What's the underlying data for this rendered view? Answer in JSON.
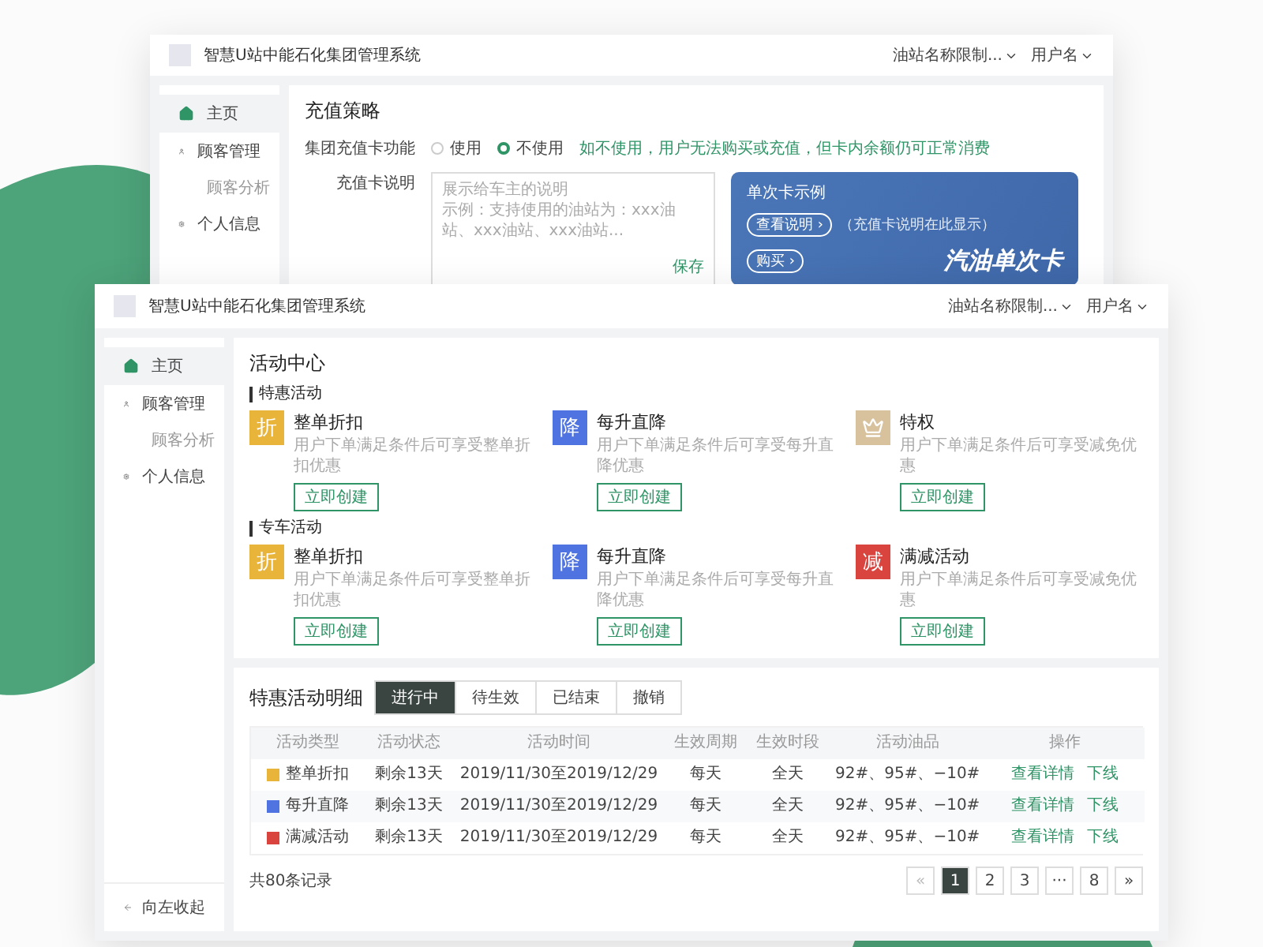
{
  "back_window": {
    "header": {
      "title": "智慧U站中能石化集团管理系统",
      "station": "油站名称限制...",
      "user": "用户名"
    },
    "sidebar": [
      {
        "label": "主页",
        "selected": true
      },
      {
        "label": "顾客管理",
        "selected": false,
        "children": [
          {
            "label": "顾客分析",
            "selected": false
          }
        ]
      },
      {
        "label": "个人信息",
        "selected": false
      }
    ],
    "content": {
      "title": "充值策略",
      "switch_label": "集团充值卡功能",
      "options": [
        {
          "label": "使用",
          "selected": false
        },
        {
          "label": "不使用",
          "selected": true
        }
      ],
      "hint": "如不使用，用户无法购买或充值，但卡内余额仍可正常消费",
      "desc_label": "充值卡说明",
      "placeholder": [
        "展示给车主的说明",
        "示例：支持使用的油站为：xxx油站、xxx油站、xxx油站..."
      ],
      "save": "保存",
      "card": {
        "title": "单次卡示例",
        "info_button": "查看说明 ›",
        "info_note": "（充值卡说明在此显示）",
        "buy_button": "购买 ›",
        "name": "汽油单次卡"
      }
    }
  },
  "front_window": {
    "header": {
      "title": "智慧U站中能石化集团管理系统",
      "station": "油站名称限制...",
      "user": "用户名"
    },
    "sidebar": [
      {
        "label": "主页",
        "selected": true
      },
      {
        "label": "顾客管理",
        "selected": false,
        "children": [
          {
            "label": "顾客分析",
            "selected": false
          }
        ]
      },
      {
        "label": "个人信息",
        "selected": false
      }
    ],
    "collapse": "向左收起",
    "activity_center": {
      "title": "活动中心",
      "sections": [
        {
          "title": "特惠活动",
          "items": [
            {
              "kind": "glyph",
              "glyph": "折",
              "color": "#e8b43a",
              "name": "整单折扣",
              "desc": "用户下单满足条件后可享受整单折扣优惠",
              "button": "立即创建"
            },
            {
              "kind": "glyph",
              "glyph": "降",
              "color": "#4f73e0",
              "name": "每升直降",
              "desc": "用户下单满足条件后可享受每升直降优惠",
              "button": "立即创建"
            },
            {
              "kind": "crown",
              "color": "#d8c29d",
              "name": "特权",
              "desc": "用户下单满足条件后可享受减免优惠",
              "button": "立即创建"
            }
          ]
        },
        {
          "title": "专车活动",
          "items": [
            {
              "kind": "glyph",
              "glyph": "折",
              "color": "#e8b43a",
              "name": "整单折扣",
              "desc": "用户下单满足条件后可享受整单折扣优惠",
              "button": "立即创建"
            },
            {
              "kind": "glyph",
              "glyph": "降",
              "color": "#4f73e0",
              "name": "每升直降",
              "desc": "用户下单满足条件后可享受每升直降优惠",
              "button": "立即创建"
            },
            {
              "kind": "glyph",
              "glyph": "减",
              "color": "#d9443f",
              "name": "满减活动",
              "desc": "用户下单满足条件后可享受减免优惠",
              "button": "立即创建"
            }
          ]
        }
      ]
    },
    "details": {
      "title": "特惠活动明细",
      "tabs": [
        {
          "label": "进行中",
          "selected": true
        },
        {
          "label": "待生效",
          "selected": false
        },
        {
          "label": "已结束",
          "selected": false
        },
        {
          "label": "撤销",
          "selected": false
        }
      ],
      "columns": [
        "活动类型",
        "活动状态",
        "活动时间",
        "生效周期",
        "生效时段",
        "活动油品",
        "操作"
      ],
      "rows": [
        {
          "color": "#e8b43a",
          "type": "整单折扣",
          "status": "剩余13天",
          "time": "2019/11/30至2019/12/29",
          "cycle": "每天",
          "period": "全天",
          "fuel": "92#、95#、−10#",
          "actions": [
            "查看详情",
            "下线"
          ]
        },
        {
          "color": "#4f73e0",
          "type": "每升直降",
          "status": "剩余13天",
          "time": "2019/11/30至2019/12/29",
          "cycle": "每天",
          "period": "全天",
          "fuel": "92#、95#、−10#",
          "actions": [
            "查看详情",
            "下线"
          ]
        },
        {
          "color": "#d9443f",
          "type": "满减活动",
          "status": "剩余13天",
          "time": "2019/11/30至2019/12/29",
          "cycle": "每天",
          "period": "全天",
          "fuel": "92#、95#、−10#",
          "actions": [
            "查看详情",
            "下线"
          ]
        }
      ],
      "total": "共80条记录",
      "pagination": {
        "prev": "«",
        "pages": [
          {
            "label": "1",
            "selected": true
          },
          {
            "label": "2",
            "selected": false
          },
          {
            "label": "3",
            "selected": false
          },
          {
            "label": "···",
            "selected": false
          },
          {
            "label": "8",
            "selected": false
          }
        ],
        "next": "»"
      }
    }
  }
}
